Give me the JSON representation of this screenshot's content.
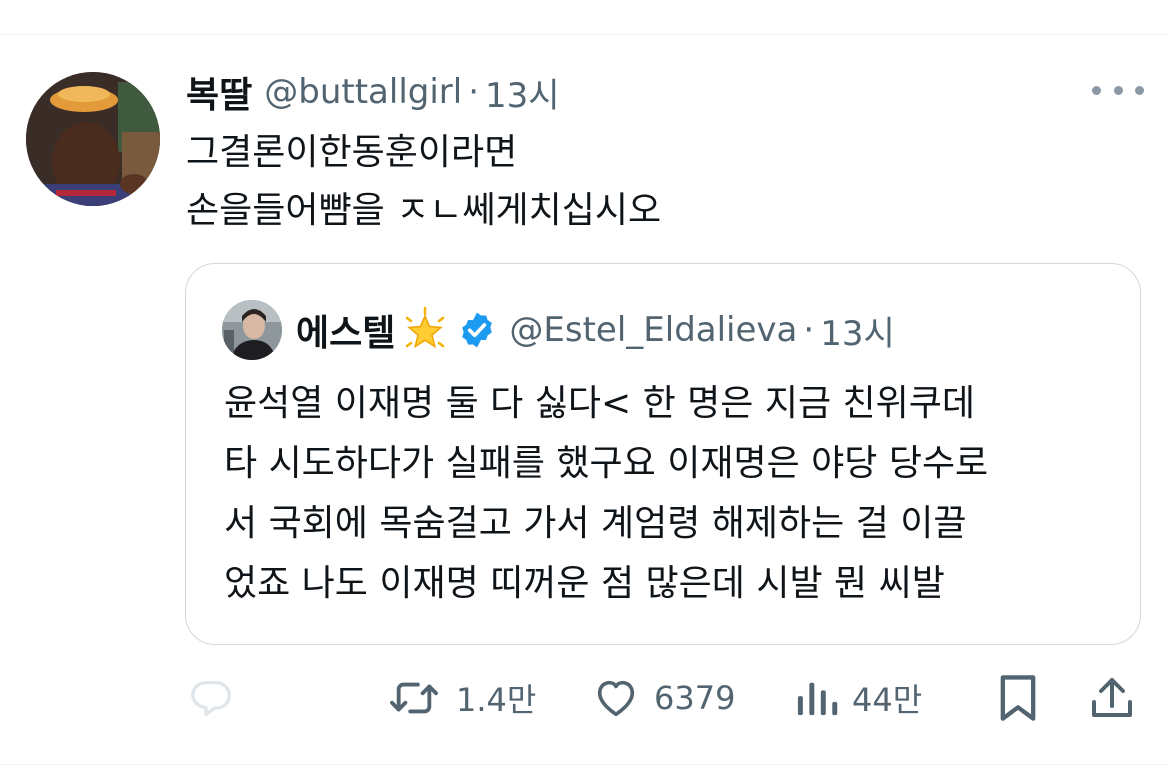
{
  "tweet": {
    "author_name": "복딸",
    "author_handle": "@buttallgirl",
    "separator": "·",
    "time": "13시",
    "text_lines": [
      "그결론이한동훈이라면",
      "손을들어뺨을 ㅈㄴ쎄게치십시오"
    ]
  },
  "quoted_tweet": {
    "author_name": "에스텔",
    "author_emoji": "glowing-star-icon",
    "verified_icon": "verified-badge-icon",
    "author_handle": "@Estel_Eldalieva",
    "separator": "·",
    "time": "13시",
    "text_lines": [
      "윤석열 이재명 둘 다 싫다< 한 명은 지금 친위쿠데",
      "타 시도하다가 실패를 했구요 이재명은 야당 당수로",
      "서 국회에 목숨걸고 가서 계엄령 해제하는 걸 이끌",
      "었죠 나도 이재명 띠꺼운 점 많은데 시발 뭔 씨발"
    ]
  },
  "actions": {
    "reply": {
      "icon": "reply-icon",
      "count": ""
    },
    "retweet": {
      "icon": "retweet-icon",
      "count": "1.4만"
    },
    "like": {
      "icon": "heart-icon",
      "count": "6379"
    },
    "views": {
      "icon": "views-icon",
      "count": "44만"
    },
    "bookmark": {
      "icon": "bookmark-icon"
    },
    "share": {
      "icon": "share-icon"
    }
  },
  "colors": {
    "text_primary": "#0f1419",
    "text_secondary": "#536471",
    "border": "#cfd9de",
    "verified": "#1d9bf0"
  }
}
